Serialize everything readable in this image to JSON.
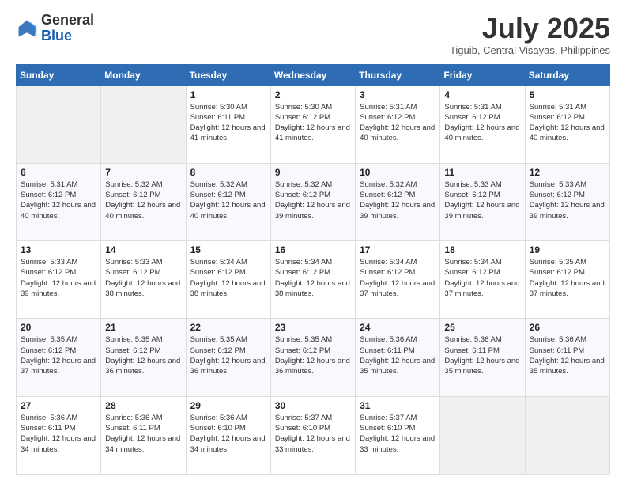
{
  "header": {
    "logo_general": "General",
    "logo_blue": "Blue",
    "month_title": "July 2025",
    "location": "Tiguib, Central Visayas, Philippines"
  },
  "weekdays": [
    "Sunday",
    "Monday",
    "Tuesday",
    "Wednesday",
    "Thursday",
    "Friday",
    "Saturday"
  ],
  "weeks": [
    [
      {
        "day": "",
        "sunrise": "",
        "sunset": "",
        "daylight": ""
      },
      {
        "day": "",
        "sunrise": "",
        "sunset": "",
        "daylight": ""
      },
      {
        "day": "1",
        "sunrise": "Sunrise: 5:30 AM",
        "sunset": "Sunset: 6:11 PM",
        "daylight": "Daylight: 12 hours and 41 minutes."
      },
      {
        "day": "2",
        "sunrise": "Sunrise: 5:30 AM",
        "sunset": "Sunset: 6:12 PM",
        "daylight": "Daylight: 12 hours and 41 minutes."
      },
      {
        "day": "3",
        "sunrise": "Sunrise: 5:31 AM",
        "sunset": "Sunset: 6:12 PM",
        "daylight": "Daylight: 12 hours and 40 minutes."
      },
      {
        "day": "4",
        "sunrise": "Sunrise: 5:31 AM",
        "sunset": "Sunset: 6:12 PM",
        "daylight": "Daylight: 12 hours and 40 minutes."
      },
      {
        "day": "5",
        "sunrise": "Sunrise: 5:31 AM",
        "sunset": "Sunset: 6:12 PM",
        "daylight": "Daylight: 12 hours and 40 minutes."
      }
    ],
    [
      {
        "day": "6",
        "sunrise": "Sunrise: 5:31 AM",
        "sunset": "Sunset: 6:12 PM",
        "daylight": "Daylight: 12 hours and 40 minutes."
      },
      {
        "day": "7",
        "sunrise": "Sunrise: 5:32 AM",
        "sunset": "Sunset: 6:12 PM",
        "daylight": "Daylight: 12 hours and 40 minutes."
      },
      {
        "day": "8",
        "sunrise": "Sunrise: 5:32 AM",
        "sunset": "Sunset: 6:12 PM",
        "daylight": "Daylight: 12 hours and 40 minutes."
      },
      {
        "day": "9",
        "sunrise": "Sunrise: 5:32 AM",
        "sunset": "Sunset: 6:12 PM",
        "daylight": "Daylight: 12 hours and 39 minutes."
      },
      {
        "day": "10",
        "sunrise": "Sunrise: 5:32 AM",
        "sunset": "Sunset: 6:12 PM",
        "daylight": "Daylight: 12 hours and 39 minutes."
      },
      {
        "day": "11",
        "sunrise": "Sunrise: 5:33 AM",
        "sunset": "Sunset: 6:12 PM",
        "daylight": "Daylight: 12 hours and 39 minutes."
      },
      {
        "day": "12",
        "sunrise": "Sunrise: 5:33 AM",
        "sunset": "Sunset: 6:12 PM",
        "daylight": "Daylight: 12 hours and 39 minutes."
      }
    ],
    [
      {
        "day": "13",
        "sunrise": "Sunrise: 5:33 AM",
        "sunset": "Sunset: 6:12 PM",
        "daylight": "Daylight: 12 hours and 39 minutes."
      },
      {
        "day": "14",
        "sunrise": "Sunrise: 5:33 AM",
        "sunset": "Sunset: 6:12 PM",
        "daylight": "Daylight: 12 hours and 38 minutes."
      },
      {
        "day": "15",
        "sunrise": "Sunrise: 5:34 AM",
        "sunset": "Sunset: 6:12 PM",
        "daylight": "Daylight: 12 hours and 38 minutes."
      },
      {
        "day": "16",
        "sunrise": "Sunrise: 5:34 AM",
        "sunset": "Sunset: 6:12 PM",
        "daylight": "Daylight: 12 hours and 38 minutes."
      },
      {
        "day": "17",
        "sunrise": "Sunrise: 5:34 AM",
        "sunset": "Sunset: 6:12 PM",
        "daylight": "Daylight: 12 hours and 37 minutes."
      },
      {
        "day": "18",
        "sunrise": "Sunrise: 5:34 AM",
        "sunset": "Sunset: 6:12 PM",
        "daylight": "Daylight: 12 hours and 37 minutes."
      },
      {
        "day": "19",
        "sunrise": "Sunrise: 5:35 AM",
        "sunset": "Sunset: 6:12 PM",
        "daylight": "Daylight: 12 hours and 37 minutes."
      }
    ],
    [
      {
        "day": "20",
        "sunrise": "Sunrise: 5:35 AM",
        "sunset": "Sunset: 6:12 PM",
        "daylight": "Daylight: 12 hours and 37 minutes."
      },
      {
        "day": "21",
        "sunrise": "Sunrise: 5:35 AM",
        "sunset": "Sunset: 6:12 PM",
        "daylight": "Daylight: 12 hours and 36 minutes."
      },
      {
        "day": "22",
        "sunrise": "Sunrise: 5:35 AM",
        "sunset": "Sunset: 6:12 PM",
        "daylight": "Daylight: 12 hours and 36 minutes."
      },
      {
        "day": "23",
        "sunrise": "Sunrise: 5:35 AM",
        "sunset": "Sunset: 6:12 PM",
        "daylight": "Daylight: 12 hours and 36 minutes."
      },
      {
        "day": "24",
        "sunrise": "Sunrise: 5:36 AM",
        "sunset": "Sunset: 6:11 PM",
        "daylight": "Daylight: 12 hours and 35 minutes."
      },
      {
        "day": "25",
        "sunrise": "Sunrise: 5:36 AM",
        "sunset": "Sunset: 6:11 PM",
        "daylight": "Daylight: 12 hours and 35 minutes."
      },
      {
        "day": "26",
        "sunrise": "Sunrise: 5:36 AM",
        "sunset": "Sunset: 6:11 PM",
        "daylight": "Daylight: 12 hours and 35 minutes."
      }
    ],
    [
      {
        "day": "27",
        "sunrise": "Sunrise: 5:36 AM",
        "sunset": "Sunset: 6:11 PM",
        "daylight": "Daylight: 12 hours and 34 minutes."
      },
      {
        "day": "28",
        "sunrise": "Sunrise: 5:36 AM",
        "sunset": "Sunset: 6:11 PM",
        "daylight": "Daylight: 12 hours and 34 minutes."
      },
      {
        "day": "29",
        "sunrise": "Sunrise: 5:36 AM",
        "sunset": "Sunset: 6:10 PM",
        "daylight": "Daylight: 12 hours and 34 minutes."
      },
      {
        "day": "30",
        "sunrise": "Sunrise: 5:37 AM",
        "sunset": "Sunset: 6:10 PM",
        "daylight": "Daylight: 12 hours and 33 minutes."
      },
      {
        "day": "31",
        "sunrise": "Sunrise: 5:37 AM",
        "sunset": "Sunset: 6:10 PM",
        "daylight": "Daylight: 12 hours and 33 minutes."
      },
      {
        "day": "",
        "sunrise": "",
        "sunset": "",
        "daylight": ""
      },
      {
        "day": "",
        "sunrise": "",
        "sunset": "",
        "daylight": ""
      }
    ]
  ]
}
